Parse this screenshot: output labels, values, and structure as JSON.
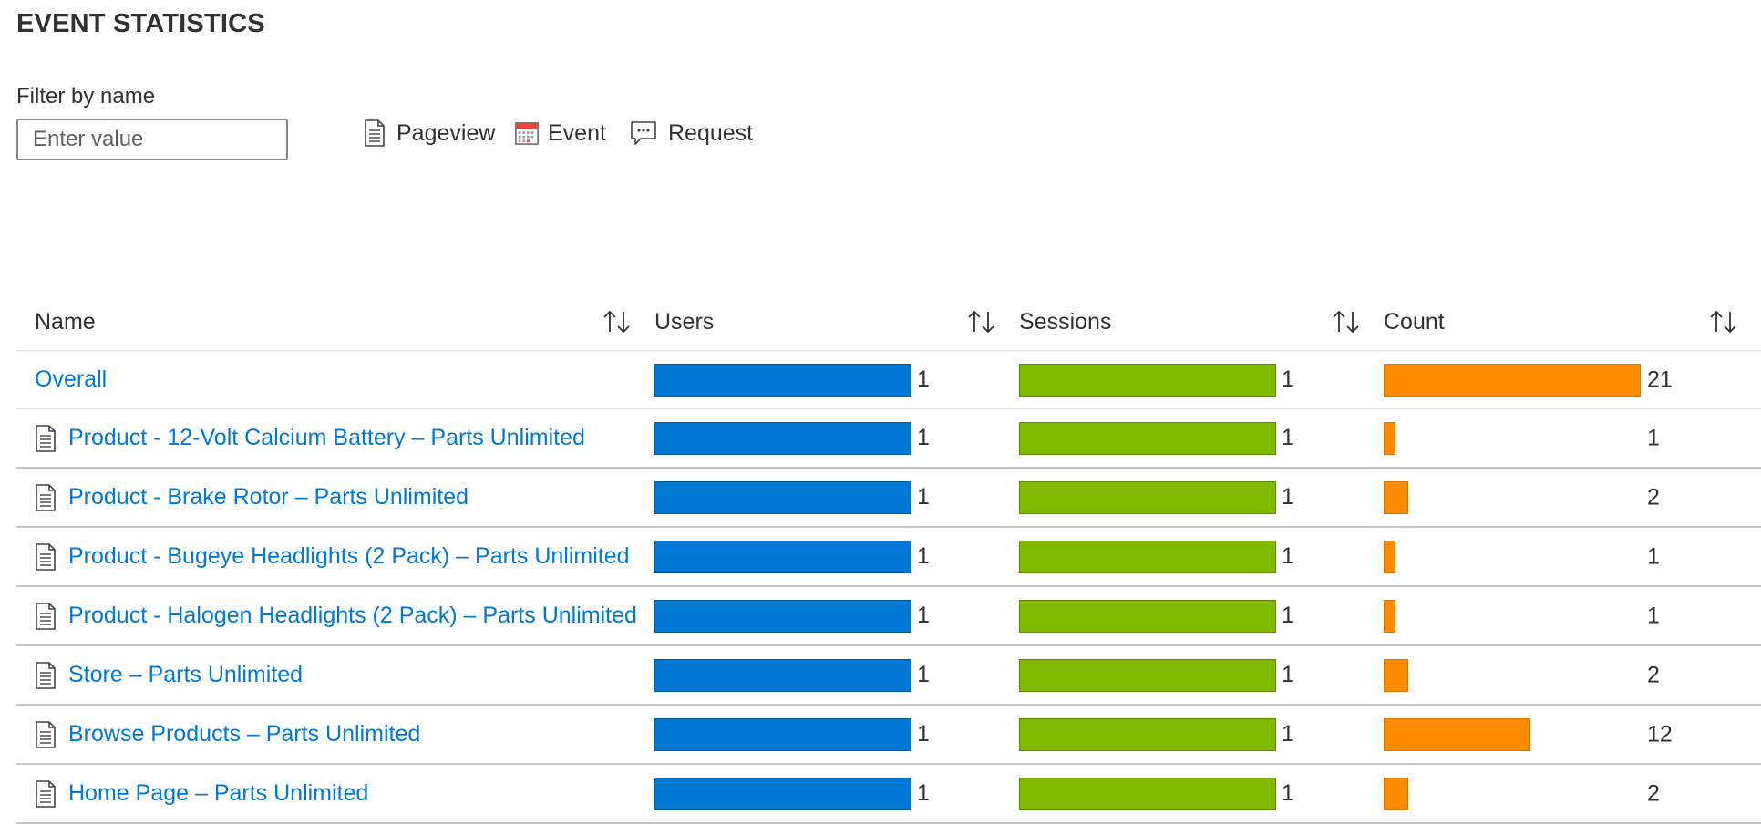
{
  "page": {
    "title": "EVENT STATISTICS"
  },
  "filter": {
    "label": "Filter by name",
    "placeholder": "Enter value",
    "value": ""
  },
  "legend": [
    {
      "icon": "pageview-icon",
      "label": "Pageview"
    },
    {
      "icon": "event-icon",
      "label": "Event"
    },
    {
      "icon": "request-icon",
      "label": "Request"
    }
  ],
  "colors": {
    "users": "#0078d4",
    "sessions": "#7fba00",
    "count": "#ff8c00",
    "link": "#0078d4"
  },
  "table": {
    "columns": [
      "Name",
      "Users",
      "Sessions",
      "Count"
    ],
    "bar_max": {
      "users": 1,
      "sessions": 1,
      "count": 21
    },
    "rows": [
      {
        "name": "Overall",
        "icon": "",
        "users": 1,
        "sessions": 1,
        "count": 21
      },
      {
        "name": "Product - 12-Volt Calcium Battery – Parts Unlimited",
        "icon": "pageview-icon",
        "users": 1,
        "sessions": 1,
        "count": 1
      },
      {
        "name": "Product - Brake Rotor – Parts Unlimited",
        "icon": "pageview-icon",
        "users": 1,
        "sessions": 1,
        "count": 2
      },
      {
        "name": "Product - Bugeye Headlights (2 Pack) – Parts Unlimited",
        "icon": "pageview-icon",
        "users": 1,
        "sessions": 1,
        "count": 1
      },
      {
        "name": "Product - Halogen Headlights (2 Pack) – Parts Unlimited",
        "icon": "pageview-icon",
        "users": 1,
        "sessions": 1,
        "count": 1
      },
      {
        "name": "Store – Parts Unlimited",
        "icon": "pageview-icon",
        "users": 1,
        "sessions": 1,
        "count": 2
      },
      {
        "name": "Browse Products – Parts Unlimited",
        "icon": "pageview-icon",
        "users": 1,
        "sessions": 1,
        "count": 12
      },
      {
        "name": "Home Page – Parts Unlimited",
        "icon": "pageview-icon",
        "users": 1,
        "sessions": 1,
        "count": 2
      }
    ]
  }
}
